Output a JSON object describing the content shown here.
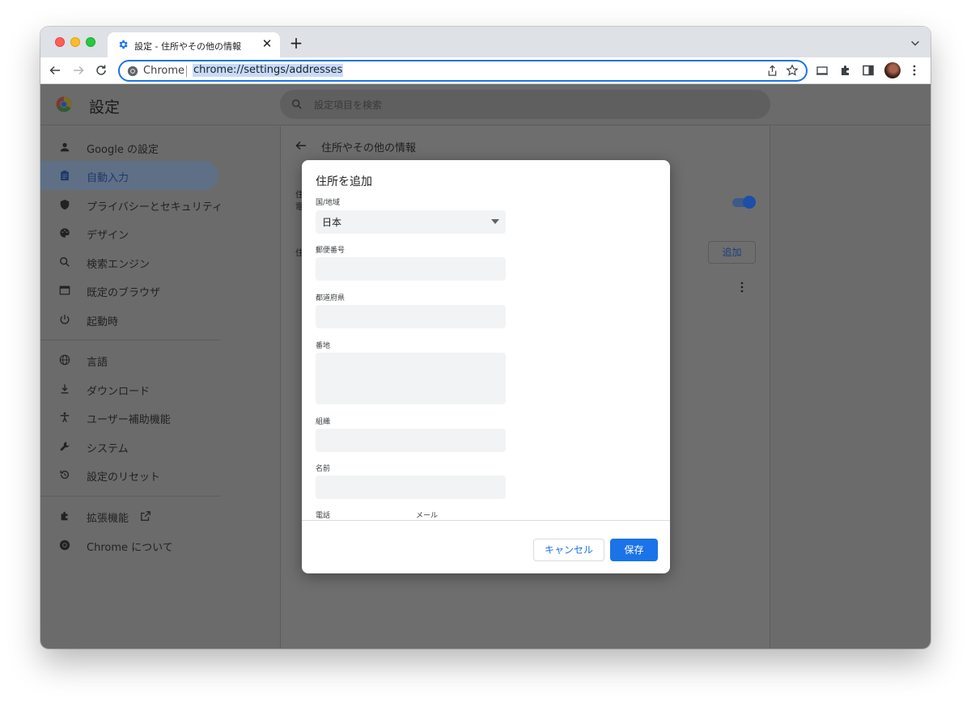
{
  "tab": {
    "title": "設定 - 住所やその他の情報",
    "close": "✕",
    "new_tab": "+"
  },
  "omnibox": {
    "chip": "Chrome",
    "url": "chrome://settings/addresses"
  },
  "header": {
    "title": "設定",
    "search_placeholder": "設定項目を検索"
  },
  "sidebar": {
    "items": [
      {
        "label": "Google の設定",
        "icon": "person-icon"
      },
      {
        "label": "自動入力",
        "icon": "clipboard-icon",
        "active": true
      },
      {
        "label": "プライバシーとセキュリティ",
        "icon": "shield-icon"
      },
      {
        "label": "デザイン",
        "icon": "palette-icon"
      },
      {
        "label": "検索エンジン",
        "icon": "search-icon"
      },
      {
        "label": "既定のブラウザ",
        "icon": "browser-icon"
      },
      {
        "label": "起動時",
        "icon": "power-icon"
      },
      {
        "label": "言語",
        "icon": "globe-icon"
      },
      {
        "label": "ダウンロード",
        "icon": "download-icon"
      },
      {
        "label": "ユーザー補助機能",
        "icon": "accessibility-icon"
      },
      {
        "label": "システム",
        "icon": "wrench-icon"
      },
      {
        "label": "設定のリセット",
        "icon": "reset-icon"
      },
      {
        "label": "拡張機能",
        "icon": "puzzle-icon"
      },
      {
        "label": "Chrome について",
        "icon": "chrome-icon"
      }
    ]
  },
  "content": {
    "subpage_title": "住所やその他の情報",
    "fragment_1": "住",
    "fragment_2": "電",
    "fragment_3": "住",
    "add_button": "追加"
  },
  "dialog": {
    "title": "住所を追加",
    "country_label": "国/地域",
    "country_value": "日本",
    "postal_label": "郵便番号",
    "prefecture_label": "都道府県",
    "street_label": "番地",
    "organization_label": "組織",
    "name_label": "名前",
    "phone_label": "電話",
    "email_label": "メール",
    "cancel": "キャンセル",
    "save": "保存"
  },
  "colors": {
    "accent": "#1a73e8",
    "dim": "#6b6b6b"
  }
}
